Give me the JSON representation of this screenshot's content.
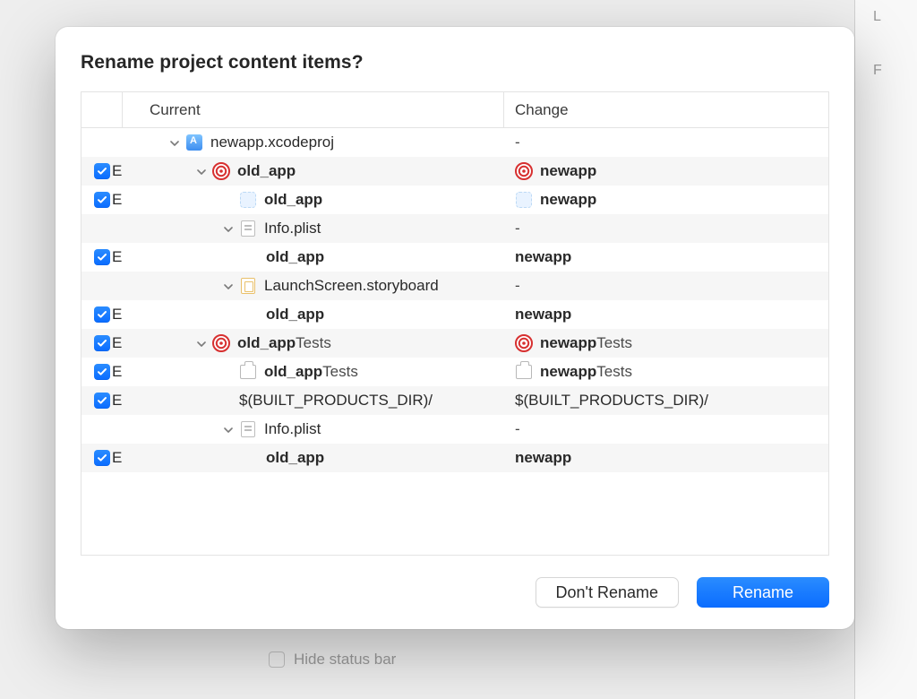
{
  "background": {
    "sidebar_letters": [
      "L",
      "F"
    ],
    "hide_status_bar": "Hide status bar"
  },
  "dialog": {
    "title": "Rename project content items?",
    "columns": {
      "current": "Current",
      "change": "Change"
    },
    "buttons": {
      "dont_rename": "Don't Rename",
      "rename": "Rename"
    }
  },
  "rows": [
    {
      "checked": false,
      "overflow": "",
      "indent": 0,
      "disclosure": true,
      "icon": "project",
      "current_bold": "",
      "current_rest": "newapp.xcodeproj",
      "change_icon": "",
      "change_bold": "",
      "change_rest": "-",
      "alt": false
    },
    {
      "checked": true,
      "overflow": "E",
      "indent": 1,
      "disclosure": true,
      "icon": "target",
      "current_bold": "old_app",
      "current_rest": "",
      "change_icon": "target",
      "change_bold": "newapp",
      "change_rest": "",
      "alt": true
    },
    {
      "checked": true,
      "overflow": "E",
      "indent": 2,
      "disclosure": false,
      "icon": "app",
      "current_bold": "old_app",
      "current_rest": "",
      "change_icon": "app",
      "change_bold": "newapp",
      "change_rest": "",
      "alt": false
    },
    {
      "checked": false,
      "overflow": "",
      "indent": 2,
      "disclosure": true,
      "icon": "plist",
      "current_bold": "",
      "current_rest": "Info.plist",
      "change_icon": "",
      "change_bold": "",
      "change_rest": "-",
      "alt": true
    },
    {
      "checked": true,
      "overflow": "E",
      "indent": 3,
      "disclosure": false,
      "icon": "",
      "current_bold": "old_app",
      "current_rest": "",
      "change_icon": "",
      "change_bold": "newapp",
      "change_rest": "",
      "alt": false
    },
    {
      "checked": false,
      "overflow": "",
      "indent": 2,
      "disclosure": true,
      "icon": "story",
      "current_bold": "",
      "current_rest": "LaunchScreen.storyboard",
      "change_icon": "",
      "change_bold": "",
      "change_rest": "-",
      "alt": true
    },
    {
      "checked": true,
      "overflow": "E",
      "indent": 3,
      "disclosure": false,
      "icon": "",
      "current_bold": "old_app",
      "current_rest": "",
      "change_icon": "",
      "change_bold": "newapp",
      "change_rest": "",
      "alt": false
    },
    {
      "checked": true,
      "overflow": "E",
      "indent": 1,
      "disclosure": true,
      "icon": "target",
      "current_bold": "old_app",
      "current_rest": "Tests",
      "change_icon": "target",
      "change_bold": "newapp",
      "change_rest": "Tests",
      "alt": true
    },
    {
      "checked": true,
      "overflow": "E",
      "indent": 2,
      "disclosure": false,
      "icon": "bundle",
      "current_bold": "old_app",
      "current_rest": "Tests",
      "change_icon": "bundle",
      "change_bold": "newapp",
      "change_rest": "Tests",
      "alt": false
    },
    {
      "checked": true,
      "overflow": "E",
      "indent": 2,
      "disclosure": false,
      "icon": "",
      "current_bold": "",
      "current_rest": "$(BUILT_PRODUCTS_DIR)/",
      "change_icon": "",
      "change_bold": "",
      "change_rest": "$(BUILT_PRODUCTS_DIR)/",
      "alt": true
    },
    {
      "checked": false,
      "overflow": "",
      "indent": 2,
      "disclosure": true,
      "icon": "plist",
      "current_bold": "",
      "current_rest": "Info.plist",
      "change_icon": "",
      "change_bold": "",
      "change_rest": "-",
      "alt": false
    },
    {
      "checked": true,
      "overflow": "E",
      "indent": 3,
      "disclosure": false,
      "icon": "",
      "current_bold": "old_app",
      "current_rest": "",
      "change_icon": "",
      "change_bold": "newapp",
      "change_rest": "",
      "alt": true
    }
  ]
}
